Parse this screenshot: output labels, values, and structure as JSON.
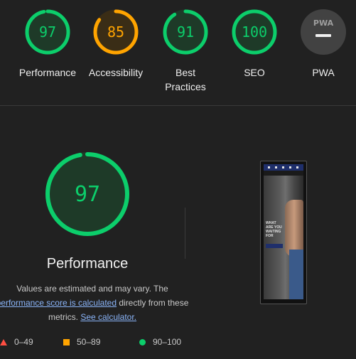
{
  "categories": [
    {
      "id": "performance",
      "score": "97",
      "label": "Performance",
      "color": "#0cce6b",
      "value": 0.97
    },
    {
      "id": "accessibility",
      "score": "85",
      "label": "Accessibility",
      "color": "#ffa400",
      "value": 0.85
    },
    {
      "id": "best-practices",
      "score": "91",
      "label": "Best\nPractices",
      "color": "#0cce6b",
      "value": 0.91
    },
    {
      "id": "seo",
      "score": "100",
      "label": "SEO",
      "color": "#0cce6b",
      "value": 1.0
    },
    {
      "id": "pwa",
      "score": "PWA",
      "label": "PWA",
      "color": "#9e9e9e",
      "value": 0
    }
  ],
  "main": {
    "score": "97",
    "score_value": 0.97,
    "title": "Performance",
    "desc_part1": "Values are estimated and may vary. The ",
    "desc_link1": "performance score is calculated",
    "desc_part2": " directly from these metrics. ",
    "desc_link2": "See calculator."
  },
  "legend": [
    {
      "range": "0–49",
      "shape": "triangle",
      "color": "#ff4e42"
    },
    {
      "range": "50–89",
      "shape": "square",
      "color": "#ffa400"
    },
    {
      "range": "90–100",
      "shape": "circle",
      "color": "#0cce6b"
    }
  ],
  "screenshot": {
    "headline": "WHAT ARE YOU WAITING FOR"
  }
}
